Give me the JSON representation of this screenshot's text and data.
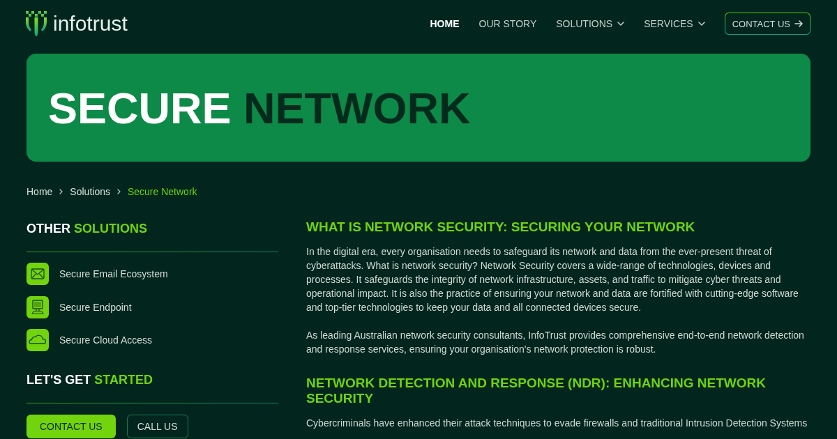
{
  "header": {
    "logo": "infotrust",
    "nav": [
      {
        "label": "HOME",
        "selected": true,
        "dropdown": false
      },
      {
        "label": "OUR STORY",
        "selected": false,
        "dropdown": false
      },
      {
        "label": "SOLUTIONS",
        "selected": false,
        "dropdown": true
      },
      {
        "label": "SERVICES",
        "selected": false,
        "dropdown": true
      }
    ],
    "cta": "CONTACT US"
  },
  "hero": {
    "title": [
      {
        "text": "SECURE",
        "kind": "light"
      },
      {
        "text": "NETWORK",
        "kind": "dark"
      }
    ]
  },
  "breadcrumb": [
    {
      "label": "Home",
      "current": false
    },
    {
      "label": "Solutions",
      "current": false
    },
    {
      "label": "Secure Network",
      "current": true
    }
  ],
  "sidebar": {
    "solutions_heading": [
      {
        "text": "OTHER",
        "accent": false
      },
      {
        "text": "SOLUTIONS",
        "accent": true
      }
    ],
    "solutions": [
      "Secure Email Ecosystem",
      "Secure Endpoint",
      "Secure Cloud Access"
    ],
    "start_heading": [
      {
        "text": "LET'S GET",
        "accent": false
      },
      {
        "text": "STARTED",
        "accent": true
      }
    ],
    "buttons": [
      {
        "label": "CONTACT US",
        "kind": "primary"
      },
      {
        "label": "CALL US",
        "kind": "outline"
      }
    ]
  },
  "article": {
    "sections": [
      {
        "heading": "WHAT IS NETWORK SECURITY: SECURING YOUR NETWORK",
        "paragraphs": [
          "In the digital era, every organisation needs to safeguard its network and data from the ever-present threat of cyberattacks. What is network security? Network Security covers a wide-range of technologies, devices and processes. It safeguards the integrity of network infrastructure, assets, and traffic to mitigate cyber threats and operational impact. It is also the practice of ensuring your network and data are fortified with cutting-edge software and top-tier technologies to keep your data and all connected devices secure.",
          "As leading Australian network security consultants, InfoTrust provides comprehensive end-to-end network detection and response services, ensuring your organisation's network protection is robust."
        ]
      },
      {
        "heading": "NETWORK DETECTION AND RESPONSE (NDR): ENHANCING NETWORK SECURITY",
        "paragraphs": [
          "Cybercriminals have enhanced their attack techniques to evade firewalls and traditional Intrusion Detection Systems"
        ]
      }
    ]
  }
}
